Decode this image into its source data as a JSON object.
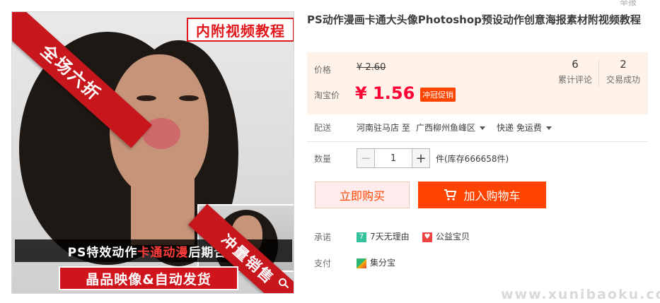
{
  "report_link": "举报",
  "product": {
    "title": "PS动作漫画卡通大头像Photoshop预设动作创意海报素材附视频教程"
  },
  "image": {
    "banner_top": "内附视频教程",
    "sash_top": "全场六折",
    "sash_bottom": "冲量销售",
    "bar1_pre": "PS特效动作",
    "bar1_highlight": "卡通动漫",
    "bar1_post": "后期合成",
    "bar2": "晶品映像&自动发货"
  },
  "price": {
    "label_price": "价格",
    "original": "¥ 2.60",
    "label_taobao": "淘宝价",
    "current": "¥ 1.56",
    "promo_tag": "冲冠促销",
    "reviews_count": "6",
    "reviews_label": "累计评论",
    "deals_count": "2",
    "deals_label": "交易成功"
  },
  "shipping": {
    "label": "配送",
    "from": "河南驻马店 至",
    "to": "广西柳州鱼峰区",
    "method": "快递 免运费"
  },
  "quantity": {
    "label": "数量",
    "minus": "−",
    "value": "1",
    "plus": "+",
    "stock": "件(库存666658件)"
  },
  "actions": {
    "buy_now": "立即购买",
    "add_to_cart": "加入购物车"
  },
  "promise": {
    "label": "承诺",
    "item1_badge": "7",
    "item1": "7天无理由",
    "item2": "公益宝贝"
  },
  "payment": {
    "label": "支付",
    "item1": "集分宝"
  },
  "watermark": "www.xunibaoku.com",
  "colors": {
    "accent": "#ff4400",
    "price_red": "#ff0036",
    "price_bg": "#fff2e8"
  }
}
